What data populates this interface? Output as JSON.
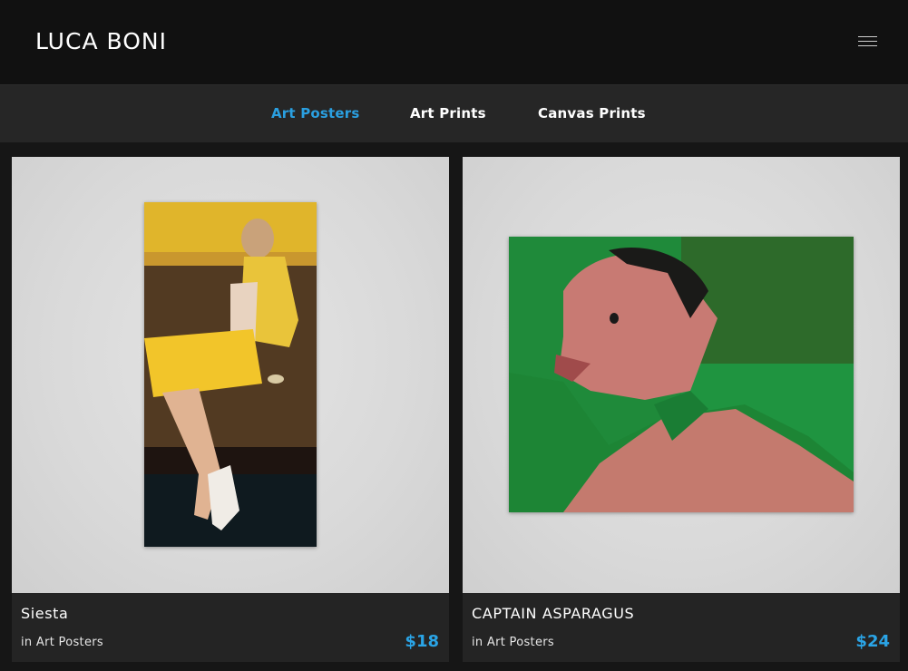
{
  "header": {
    "brand": "LUCA BONI",
    "menu_icon": "hamburger-menu-icon"
  },
  "category_nav": {
    "tabs": [
      {
        "label": "Art Posters",
        "active": true
      },
      {
        "label": "Art Prints",
        "active": false
      },
      {
        "label": "Canvas Prints",
        "active": false
      }
    ]
  },
  "products": [
    {
      "title": "Siesta",
      "category": "in Art Posters",
      "price": "$18"
    },
    {
      "title": "CAPTAIN ASPARAGUS",
      "category": "in Art Posters",
      "price": "$24"
    }
  ],
  "colors": {
    "accent": "#2a9fe0",
    "header_bg": "#111111",
    "nav_bg": "#262626",
    "card_bg": "#242424"
  }
}
